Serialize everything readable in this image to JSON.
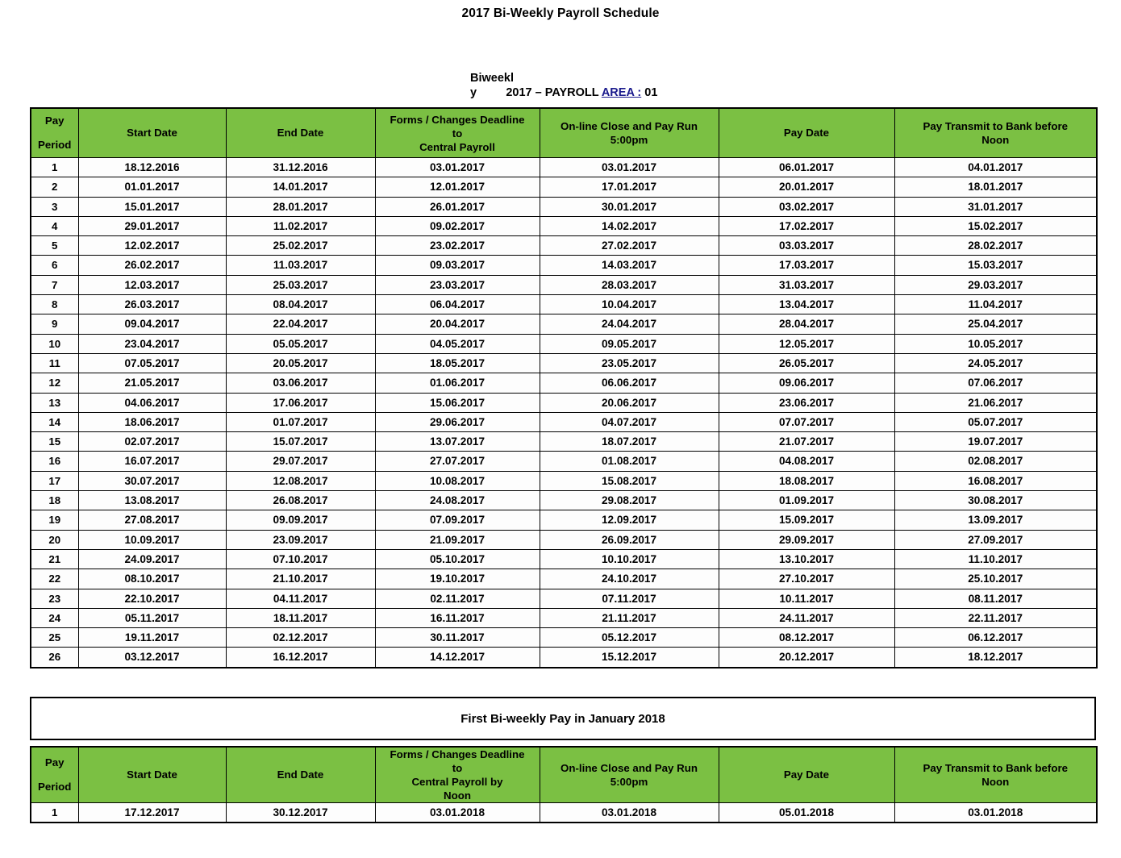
{
  "document": {
    "title": "2017 Bi-Weekly Payroll Schedule",
    "subheading_line1": "Biweekl",
    "subheading_line2_prefix": "y",
    "subheading_line2_spacer": "         ",
    "subheading_line2_main": "2017 – PAYROLL ",
    "subheading_area_link": "AREA :",
    "subheading_line2_suffix": " 01",
    "accent_green": "#7BC043",
    "link_color": "#1a1a8c",
    "border_color": "#000000",
    "page_background": "#ffffff"
  },
  "main_table": {
    "headers": {
      "pay_period_line1": "Pay",
      "pay_period_line2": "Period",
      "start_date": "Start Date",
      "end_date": "End Date",
      "forms_line1": "Forms / Changes Deadline",
      "forms_line2": "to",
      "forms_line3": "Central Payroll",
      "online_line1": "On-line Close and Pay Run",
      "online_line2": "5:00pm",
      "pay_date": "Pay Date",
      "bank_line1": "Pay Transmit to Bank before",
      "bank_line2": "Noon"
    },
    "rows": [
      {
        "period": "1",
        "start": "18.12.2016",
        "end": "31.12.2016",
        "forms": "03.01.2017",
        "online": "03.01.2017",
        "pay_date": "06.01.2017",
        "bank": "04.01.2017"
      },
      {
        "period": "2",
        "start": "01.01.2017",
        "end": "14.01.2017",
        "forms": "12.01.2017",
        "online": "17.01.2017",
        "pay_date": "20.01.2017",
        "bank": "18.01.2017"
      },
      {
        "period": "3",
        "start": "15.01.2017",
        "end": "28.01.2017",
        "forms": "26.01.2017",
        "online": "30.01.2017",
        "pay_date": "03.02.2017",
        "bank": "31.01.2017"
      },
      {
        "period": "4",
        "start": "29.01.2017",
        "end": "11.02.2017",
        "forms": "09.02.2017",
        "online": "14.02.2017",
        "pay_date": "17.02.2017",
        "bank": "15.02.2017"
      },
      {
        "period": "5",
        "start": "12.02.2017",
        "end": "25.02.2017",
        "forms": "23.02.2017",
        "online": "27.02.2017",
        "pay_date": "03.03.2017",
        "bank": "28.02.2017"
      },
      {
        "period": "6",
        "start": "26.02.2017",
        "end": "11.03.2017",
        "forms": "09.03.2017",
        "online": "14.03.2017",
        "pay_date": "17.03.2017",
        "bank": "15.03.2017"
      },
      {
        "period": "7",
        "start": "12.03.2017",
        "end": "25.03.2017",
        "forms": "23.03.2017",
        "online": "28.03.2017",
        "pay_date": "31.03.2017",
        "bank": "29.03.2017"
      },
      {
        "period": "8",
        "start": "26.03.2017",
        "end": "08.04.2017",
        "forms": "06.04.2017",
        "online": "10.04.2017",
        "pay_date": "13.04.2017",
        "bank": "11.04.2017"
      },
      {
        "period": "9",
        "start": "09.04.2017",
        "end": "22.04.2017",
        "forms": "20.04.2017",
        "online": "24.04.2017",
        "pay_date": "28.04.2017",
        "bank": "25.04.2017"
      },
      {
        "period": "10",
        "start": "23.04.2017",
        "end": "05.05.2017",
        "forms": "04.05.2017",
        "online": "09.05.2017",
        "pay_date": "12.05.2017",
        "bank": "10.05.2017"
      },
      {
        "period": "11",
        "start": "07.05.2017",
        "end": "20.05.2017",
        "forms": "18.05.2017",
        "online": "23.05.2017",
        "pay_date": "26.05.2017",
        "bank": "24.05.2017"
      },
      {
        "period": "12",
        "start": "21.05.2017",
        "end": "03.06.2017",
        "forms": "01.06.2017",
        "online": "06.06.2017",
        "pay_date": "09.06.2017",
        "bank": "07.06.2017"
      },
      {
        "period": "13",
        "start": "04.06.2017",
        "end": "17.06.2017",
        "forms": "15.06.2017",
        "online": "20.06.2017",
        "pay_date": "23.06.2017",
        "bank": "21.06.2017"
      },
      {
        "period": "14",
        "start": "18.06.2017",
        "end": "01.07.2017",
        "forms": "29.06.2017",
        "online": "04.07.2017",
        "pay_date": "07.07.2017",
        "bank": "05.07.2017"
      },
      {
        "period": "15",
        "start": "02.07.2017",
        "end": "15.07.2017",
        "forms": "13.07.2017",
        "online": "18.07.2017",
        "pay_date": "21.07.2017",
        "bank": "19.07.2017"
      },
      {
        "period": "16",
        "start": "16.07.2017",
        "end": "29.07.2017",
        "forms": "27.07.2017",
        "online": "01.08.2017",
        "pay_date": "04.08.2017",
        "bank": "02.08.2017"
      },
      {
        "period": "17",
        "start": "30.07.2017",
        "end": "12.08.2017",
        "forms": "10.08.2017",
        "online": "15.08.2017",
        "pay_date": "18.08.2017",
        "bank": "16.08.2017"
      },
      {
        "period": "18",
        "start": "13.08.2017",
        "end": "26.08.2017",
        "forms": "24.08.2017",
        "online": "29.08.2017",
        "pay_date": "01.09.2017",
        "bank": "30.08.2017"
      },
      {
        "period": "19",
        "start": "27.08.2017",
        "end": "09.09.2017",
        "forms": "07.09.2017",
        "online": "12.09.2017",
        "pay_date": "15.09.2017",
        "bank": "13.09.2017"
      },
      {
        "period": "20",
        "start": "10.09.2017",
        "end": "23.09.2017",
        "forms": "21.09.2017",
        "online": "26.09.2017",
        "pay_date": "29.09.2017",
        "bank": "27.09.2017"
      },
      {
        "period": "21",
        "start": "24.09.2017",
        "end": "07.10.2017",
        "forms": "05.10.2017",
        "online": "10.10.2017",
        "pay_date": "13.10.2017",
        "bank": "11.10.2017"
      },
      {
        "period": "22",
        "start": "08.10.2017",
        "end": "21.10.2017",
        "forms": "19.10.2017",
        "online": "24.10.2017",
        "pay_date": "27.10.2017",
        "bank": "25.10.2017"
      },
      {
        "period": "23",
        "start": "22.10.2017",
        "end": "04.11.2017",
        "forms": "02.11.2017",
        "online": "07.11.2017",
        "pay_date": "10.11.2017",
        "bank": "08.11.2017"
      },
      {
        "period": "24",
        "start": "05.11.2017",
        "end": "18.11.2017",
        "forms": "16.11.2017",
        "online": "21.11.2017",
        "pay_date": "24.11.2017",
        "bank": "22.11.2017"
      },
      {
        "period": "25",
        "start": "19.11.2017",
        "end": "02.12.2017",
        "forms": "30.11.2017",
        "online": "05.12.2017",
        "pay_date": "08.12.2017",
        "bank": "06.12.2017"
      },
      {
        "period": "26",
        "start": "03.12.2017",
        "end": "16.12.2017",
        "forms": "14.12.2017",
        "online": "15.12.2017",
        "pay_date": "20.12.2017",
        "bank": "18.12.2017"
      }
    ]
  },
  "banner": {
    "text": "First Bi-weekly Pay in January 2018"
  },
  "next_year_table": {
    "headers": {
      "pay_period_line1": "Pay",
      "pay_period_line2": "Period",
      "start_date": "Start Date",
      "end_date": "End Date",
      "forms_line1": "Forms / Changes Deadline",
      "forms_line2": "to",
      "forms_line3": "Central Payroll by",
      "forms_line4": "Noon",
      "online_line1": "On-line Close and Pay Run",
      "online_line2": "5:00pm",
      "pay_date": "Pay Date",
      "bank_line1": "Pay Transmit to Bank before",
      "bank_line2": "Noon"
    },
    "rows": [
      {
        "period": "1",
        "start": "17.12.2017",
        "end": "30.12.2017",
        "forms": "03.01.2018",
        "online": "03.01.2018",
        "pay_date": "05.01.2018",
        "bank": "03.01.2018"
      }
    ]
  }
}
